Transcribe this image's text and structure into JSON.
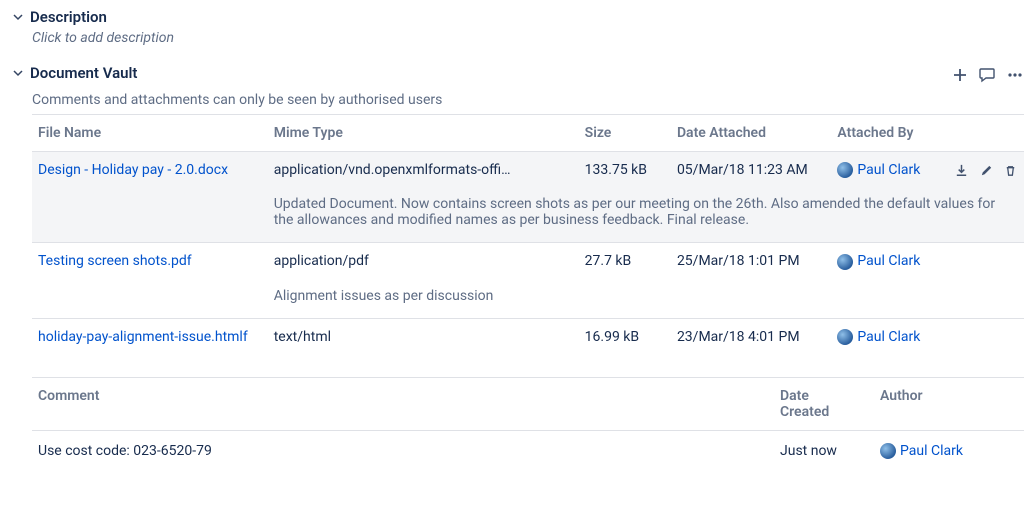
{
  "description": {
    "title": "Description",
    "placeholder": "Click to add description"
  },
  "vault": {
    "title": "Document Vault",
    "auth_note": "Comments and attachments can only be seen by authorised users",
    "columns": {
      "file": "File Name",
      "mime": "Mime Type",
      "size": "Size",
      "date": "Date Attached",
      "user": "Attached By"
    },
    "rows": [
      {
        "file": "Design - Holiday pay - 2.0.docx",
        "mime": "application/vnd.openxmlformats-offi…",
        "size": "133.75 kB",
        "date": "05/Mar/18 11:23 AM",
        "user": "Paul Clark",
        "note": "Updated Document. Now contains screen shots as per our meeting on the 26th. Also amended the default values for the allowances and modified names as per business feedback. Final release.",
        "highlighted": true
      },
      {
        "file": "Testing screen shots.pdf",
        "mime": "application/pdf",
        "size": "27.7 kB",
        "date": "25/Mar/18 1:01 PM",
        "user": "Paul Clark",
        "note": "Alignment issues as per discussion"
      },
      {
        "file": "holiday-pay-alignment-issue.htmlf",
        "mime": "text/html",
        "size": "16.99 kB",
        "date": "23/Mar/18 4:01 PM",
        "user": "Paul Clark"
      }
    ],
    "comments_header": {
      "comment": "Comment",
      "date": "Date Created",
      "author": "Author"
    },
    "comments": [
      {
        "text": "Use cost code: 023-6520-79",
        "date": "Just now",
        "author": "Paul Clark"
      }
    ]
  }
}
